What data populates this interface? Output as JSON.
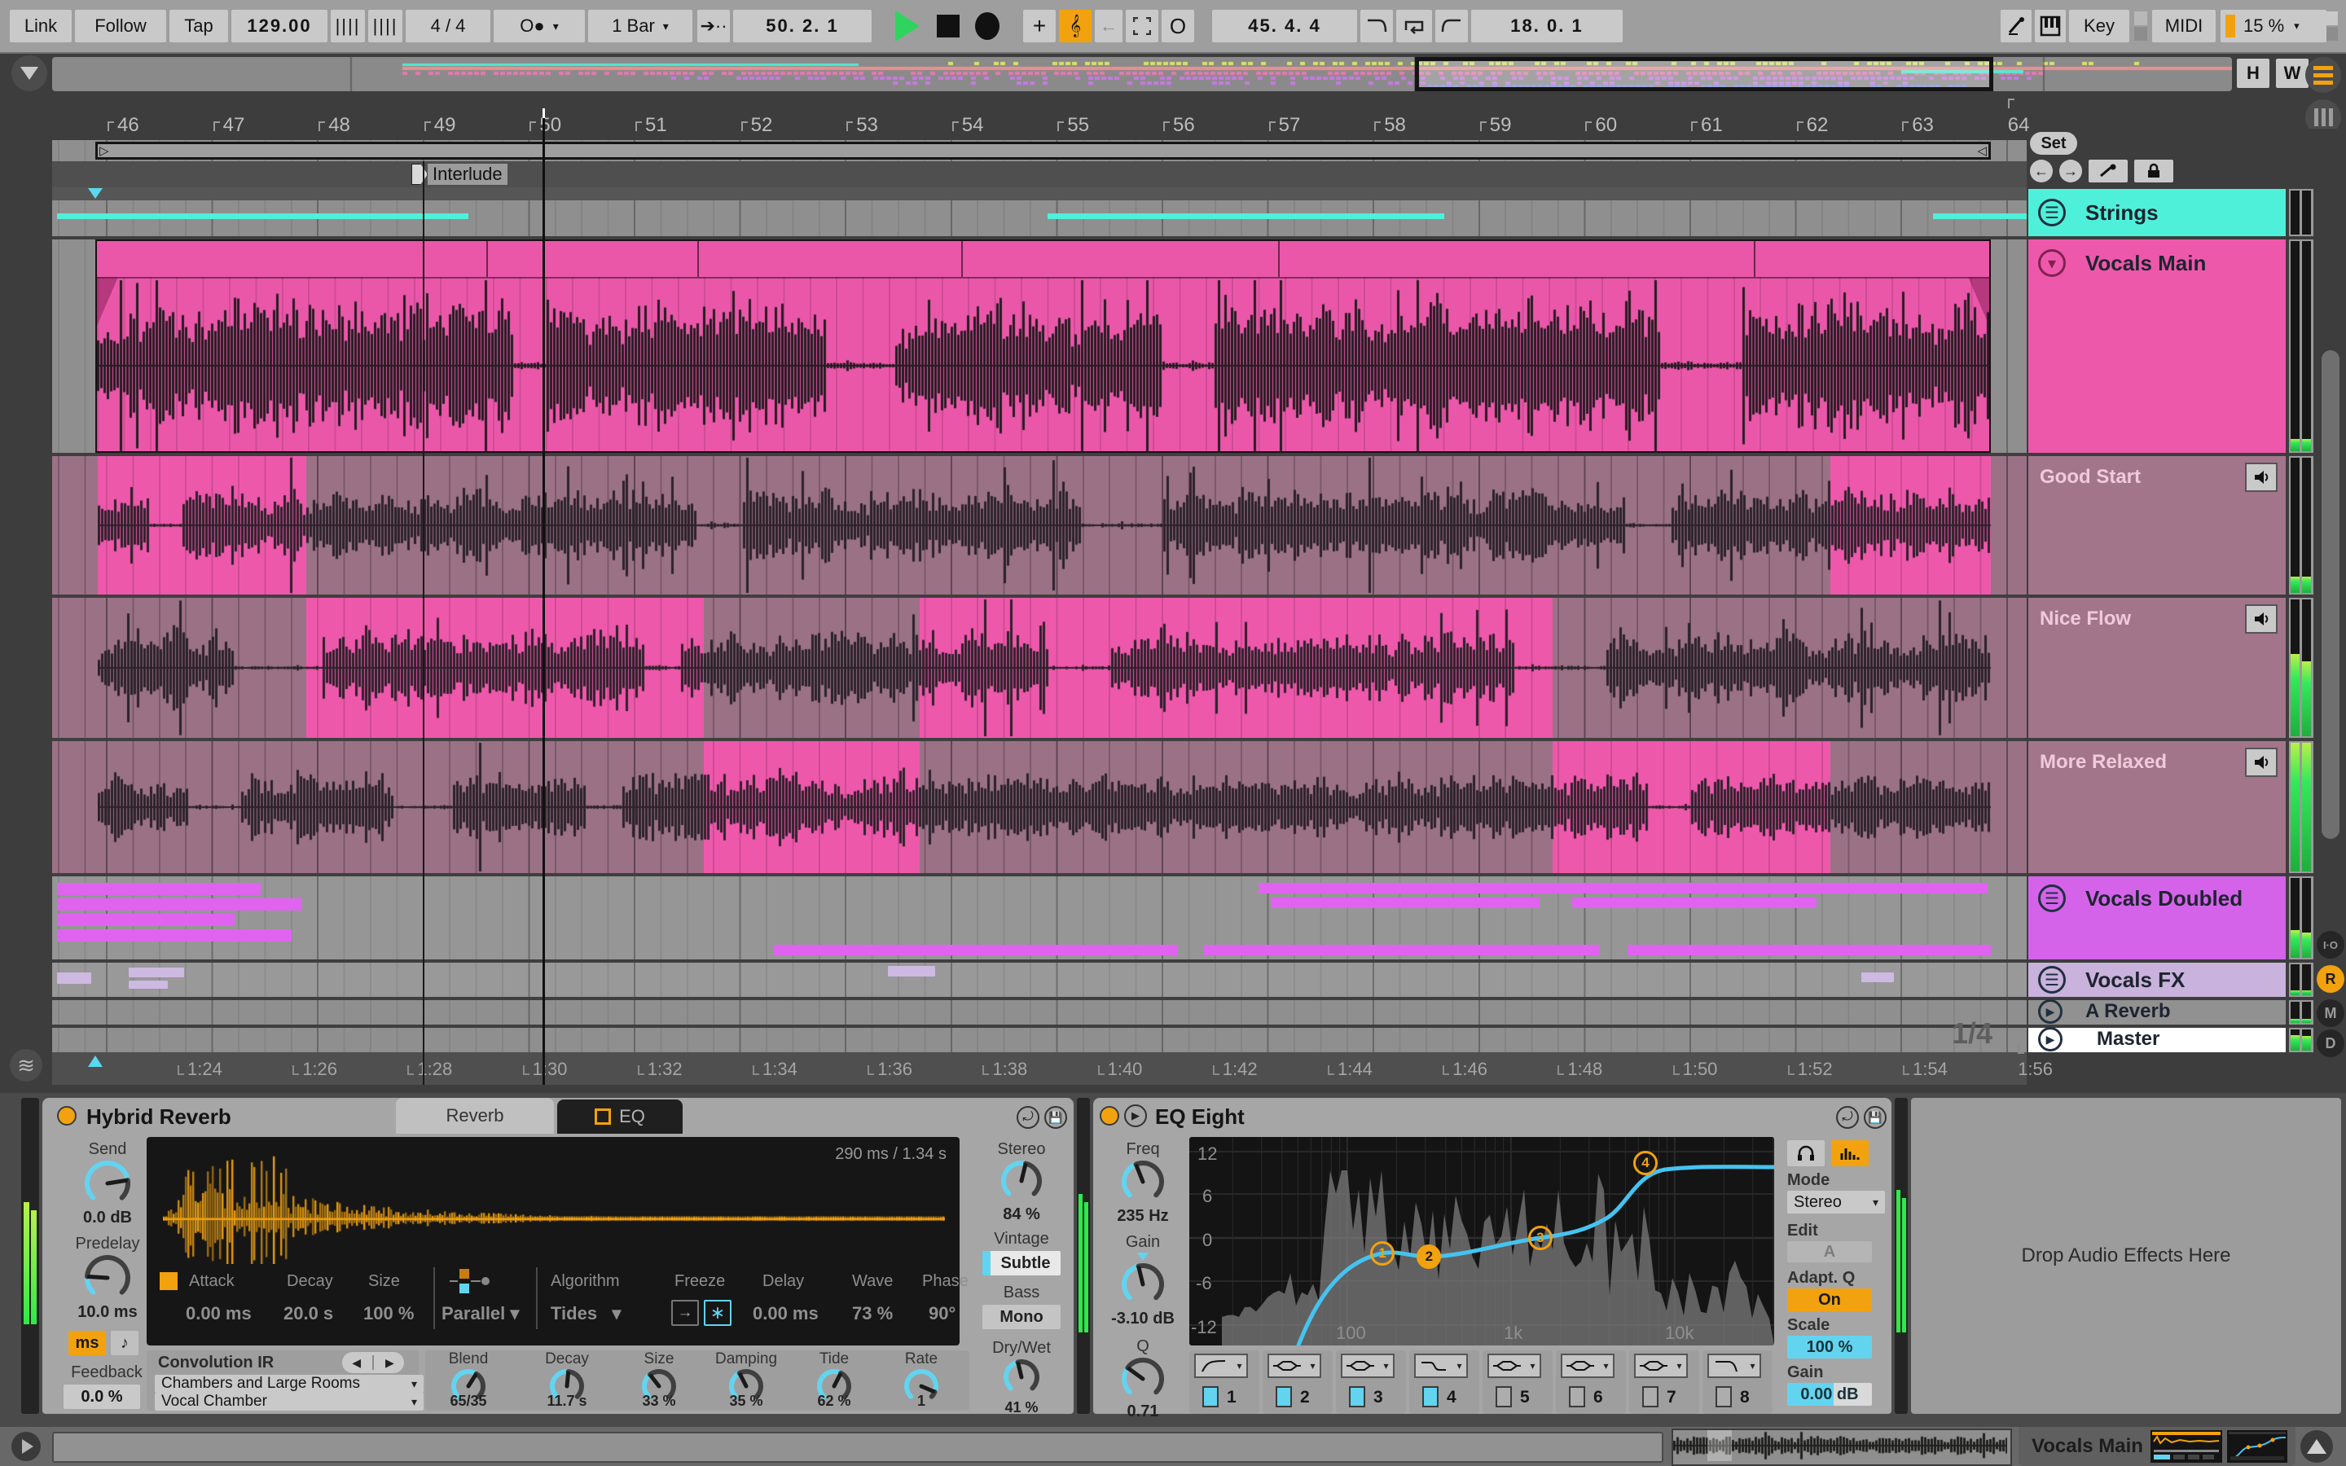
{
  "toolbar": {
    "link": "Link",
    "follow": "Follow",
    "tap": "Tap",
    "tempo": "129.00",
    "time_signature": "4 / 4",
    "metronome": "O●",
    "quantization": "1 Bar",
    "arrangement_position": "50. 2. 1",
    "loop_start": "45. 4. 4",
    "loop_length": "18. 0. 1",
    "key_label": "Key",
    "midi_label": "MIDI",
    "cpu_load": "15 %"
  },
  "overview": {
    "height_btn": "H",
    "width_btn": "W"
  },
  "arrangement": {
    "bar_numbers": [
      "46",
      "47",
      "48",
      "49",
      "50",
      "51",
      "52",
      "53",
      "54",
      "55",
      "56",
      "57",
      "58",
      "59",
      "60",
      "61",
      "62",
      "63",
      "64"
    ],
    "locator": "Interlude",
    "set_button": "Set",
    "zoom_denominator": "1/4",
    "time_labels": [
      "1:24",
      "1:26",
      "1:28",
      "1:30",
      "1:32",
      "1:34",
      "1:36",
      "1:38",
      "1:40",
      "1:42",
      "1:44",
      "1:46",
      "1:48",
      "1:50",
      "1:52",
      "1:54",
      "1:56"
    ]
  },
  "tracks": [
    {
      "name": "Strings"
    },
    {
      "name": "Vocals Main"
    },
    {
      "name": "Good Start"
    },
    {
      "name": "Nice Flow"
    },
    {
      "name": "More Relaxed"
    },
    {
      "name": "Vocals Doubled"
    },
    {
      "name": "Vocals FX"
    },
    {
      "name": "A Reverb"
    },
    {
      "name": "Master"
    }
  ],
  "side_buttons": {
    "io": "I·O",
    "r": "R",
    "m": "M",
    "d": "D"
  },
  "devices": {
    "hybrid_reverb": {
      "title": "Hybrid Reverb",
      "tab_reverb": "Reverb",
      "tab_eq": "EQ",
      "send": {
        "label": "Send",
        "value": "0.0 dB"
      },
      "predelay": {
        "label": "Predelay",
        "value": "10.0 ms"
      },
      "ms_toggle": "ms",
      "feedback": {
        "label": "Feedback",
        "value": "0.0 %"
      },
      "ir_time": "290 ms / 1.34 s",
      "attack": {
        "label": "Attack",
        "value": "0.00 ms"
      },
      "decay_conv": {
        "label": "Decay",
        "value": "20.0 s"
      },
      "size_conv": {
        "label": "Size",
        "value": "100 %"
      },
      "routing": {
        "value": "Parallel"
      },
      "algorithm": {
        "label": "Algorithm",
        "value": "Tides"
      },
      "freeze_label": "Freeze",
      "delay": {
        "label": "Delay",
        "value": "0.00 ms"
      },
      "wave": {
        "label": "Wave",
        "value": "73 %"
      },
      "phase": {
        "label": "Phase",
        "value": "90°"
      },
      "convolution": {
        "label": "Convolution IR",
        "category": "Chambers and Large Rooms",
        "ir": "Vocal Chamber"
      },
      "blend": {
        "label": "Blend",
        "value": "65/35"
      },
      "decay": {
        "label": "Decay",
        "value": "11.7 s"
      },
      "size": {
        "label": "Size",
        "value": "33 %"
      },
      "damping": {
        "label": "Damping",
        "value": "35 %"
      },
      "tide": {
        "label": "Tide",
        "value": "62 %"
      },
      "rate": {
        "label": "Rate",
        "value": "1"
      },
      "stereo": {
        "label": "Stereo",
        "value": "84 %"
      },
      "vintage": {
        "label": "Vintage",
        "value": "Subtle"
      },
      "bass": {
        "label": "Bass",
        "value": "Mono"
      },
      "drywet": {
        "label": "Dry/Wet",
        "value": "41 %"
      }
    },
    "eq_eight": {
      "title": "EQ Eight",
      "freq": {
        "label": "Freq",
        "value": "235 Hz"
      },
      "gain": {
        "label": "Gain",
        "value": "-3.10 dB"
      },
      "q": {
        "label": "Q",
        "value": "0.71"
      },
      "db_ticks": [
        "12",
        "6",
        "0",
        "-6",
        "-12"
      ],
      "freq_ticks": [
        "100",
        "1k",
        "10k"
      ],
      "mode": {
        "label": "Mode",
        "value": "Stereo"
      },
      "edit": {
        "label": "Edit",
        "value": "A"
      },
      "adapt_q": {
        "label": "Adapt. Q",
        "value": "On"
      },
      "scale": {
        "label": "Scale",
        "value": "100 %"
      },
      "out_gain": {
        "label": "Gain",
        "value": "0.00 dB"
      },
      "bands": [
        {
          "n": "1",
          "active": true,
          "shape": "highpass"
        },
        {
          "n": "2",
          "active": true,
          "shape": "bell"
        },
        {
          "n": "3",
          "active": true,
          "shape": "bell"
        },
        {
          "n": "4",
          "active": true,
          "shape": "shelf"
        },
        {
          "n": "5",
          "active": false,
          "shape": "bell"
        },
        {
          "n": "6",
          "active": false,
          "shape": "bell"
        },
        {
          "n": "7",
          "active": false,
          "shape": "bell"
        },
        {
          "n": "8",
          "active": false,
          "shape": "lowpass"
        }
      ],
      "nodes": [
        {
          "n": "1",
          "fx": 0.33,
          "fy": 0.56,
          "filled": false
        },
        {
          "n": "2",
          "fx": 0.41,
          "fy": 0.576,
          "filled": true
        },
        {
          "n": "3",
          "fx": 0.6,
          "fy": 0.486,
          "filled": false
        },
        {
          "n": "4",
          "fx": 0.78,
          "fy": 0.125,
          "filled": false
        }
      ]
    },
    "drop_zone": "Drop Audio Effects Here"
  },
  "status_bar": {
    "clip_name": "Vocals Main"
  },
  "colors": {
    "accent_orange": "#f2a20f",
    "accent_cyan": "#62d4f0",
    "clip_pink": "#ee58ab",
    "strings_cyan": "#4ff0d9",
    "meter_green": "#35e85a",
    "play_green": "#2fd45e"
  }
}
